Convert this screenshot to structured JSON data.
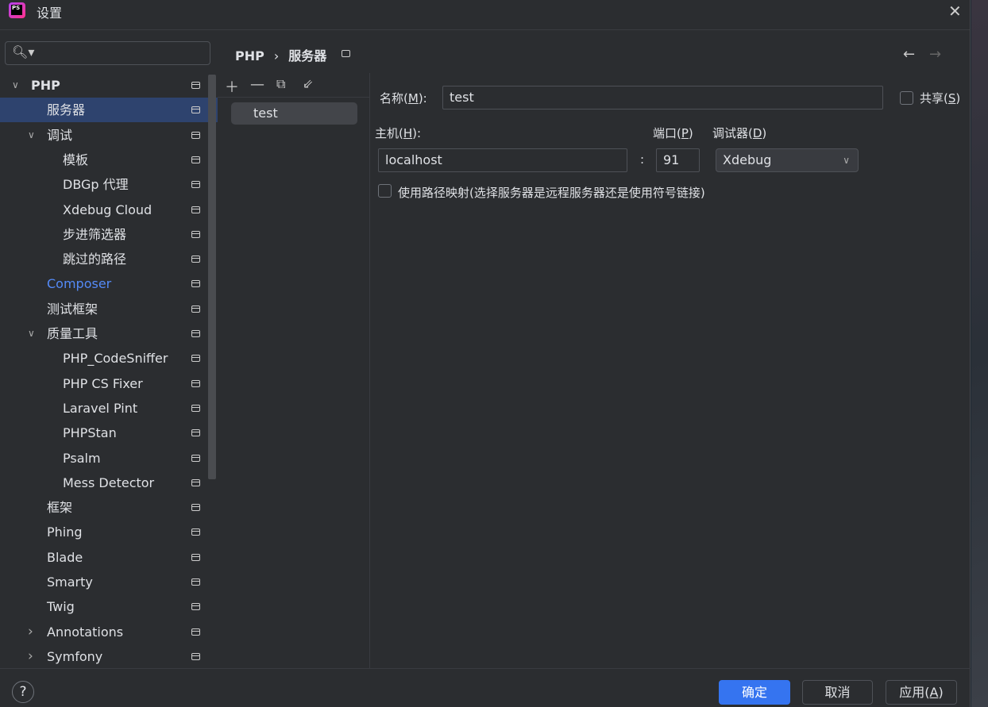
{
  "window": {
    "title": "设置",
    "logo": "PS"
  },
  "tree": [
    {
      "label": "PHP",
      "level": 0,
      "chevron": "down",
      "bold": true
    },
    {
      "label": "服务器",
      "level": 1,
      "selected": true
    },
    {
      "label": "调试",
      "level": 1,
      "chevron": "down"
    },
    {
      "label": "模板",
      "level": 2
    },
    {
      "label": "DBGp 代理",
      "level": 2
    },
    {
      "label": "Xdebug Cloud",
      "level": 2
    },
    {
      "label": "步进筛选器",
      "level": 2
    },
    {
      "label": "跳过的路径",
      "level": 2
    },
    {
      "label": "Composer",
      "level": 1,
      "link": true
    },
    {
      "label": "测试框架",
      "level": 1
    },
    {
      "label": "质量工具",
      "level": 1,
      "chevron": "down"
    },
    {
      "label": "PHP_CodeSniffer",
      "level": 2
    },
    {
      "label": "PHP CS Fixer",
      "level": 2
    },
    {
      "label": "Laravel Pint",
      "level": 2
    },
    {
      "label": "PHPStan",
      "level": 2
    },
    {
      "label": "Psalm",
      "level": 2
    },
    {
      "label": "Mess Detector",
      "level": 2
    },
    {
      "label": "框架",
      "level": 1
    },
    {
      "label": "Phing",
      "level": 1
    },
    {
      "label": "Blade",
      "level": 1
    },
    {
      "label": "Smarty",
      "level": 1
    },
    {
      "label": "Twig",
      "level": 1
    },
    {
      "label": "Annotations",
      "level": 1,
      "chevron": "right"
    },
    {
      "label": "Symfony",
      "level": 1,
      "chevron": "right"
    }
  ],
  "breadcrumb": [
    "PHP",
    "›",
    "服务器"
  ],
  "servers": [
    "test"
  ],
  "form": {
    "name_label": "名称(",
    "name_key": "M",
    "name_end": "):",
    "name_value": "test",
    "share_label": "共享(",
    "share_key": "S",
    "share_end": ")",
    "share_checked": false,
    "host_label": "主机(",
    "host_key": "H",
    "host_end": "):",
    "host_value": "localhost",
    "colon": ":",
    "port_label": "端口(",
    "port_key": "P",
    "port_end": ")",
    "port_value": "91",
    "debugger_label": "调试器(",
    "debugger_key": "D",
    "debugger_end": ")",
    "debugger_value": "Xdebug",
    "mapping_label": "使用路径映射(选择服务器是远程服务器还是使用符号链接)",
    "mapping_checked": false
  },
  "footer": {
    "help": "?",
    "ok": "确定",
    "cancel": "取消",
    "apply": "应用(",
    "apply_key": "A",
    "apply_end": ")"
  },
  "colors": {
    "accent": "#3574f0",
    "selection": "#2e436e",
    "link": "#548af7"
  }
}
